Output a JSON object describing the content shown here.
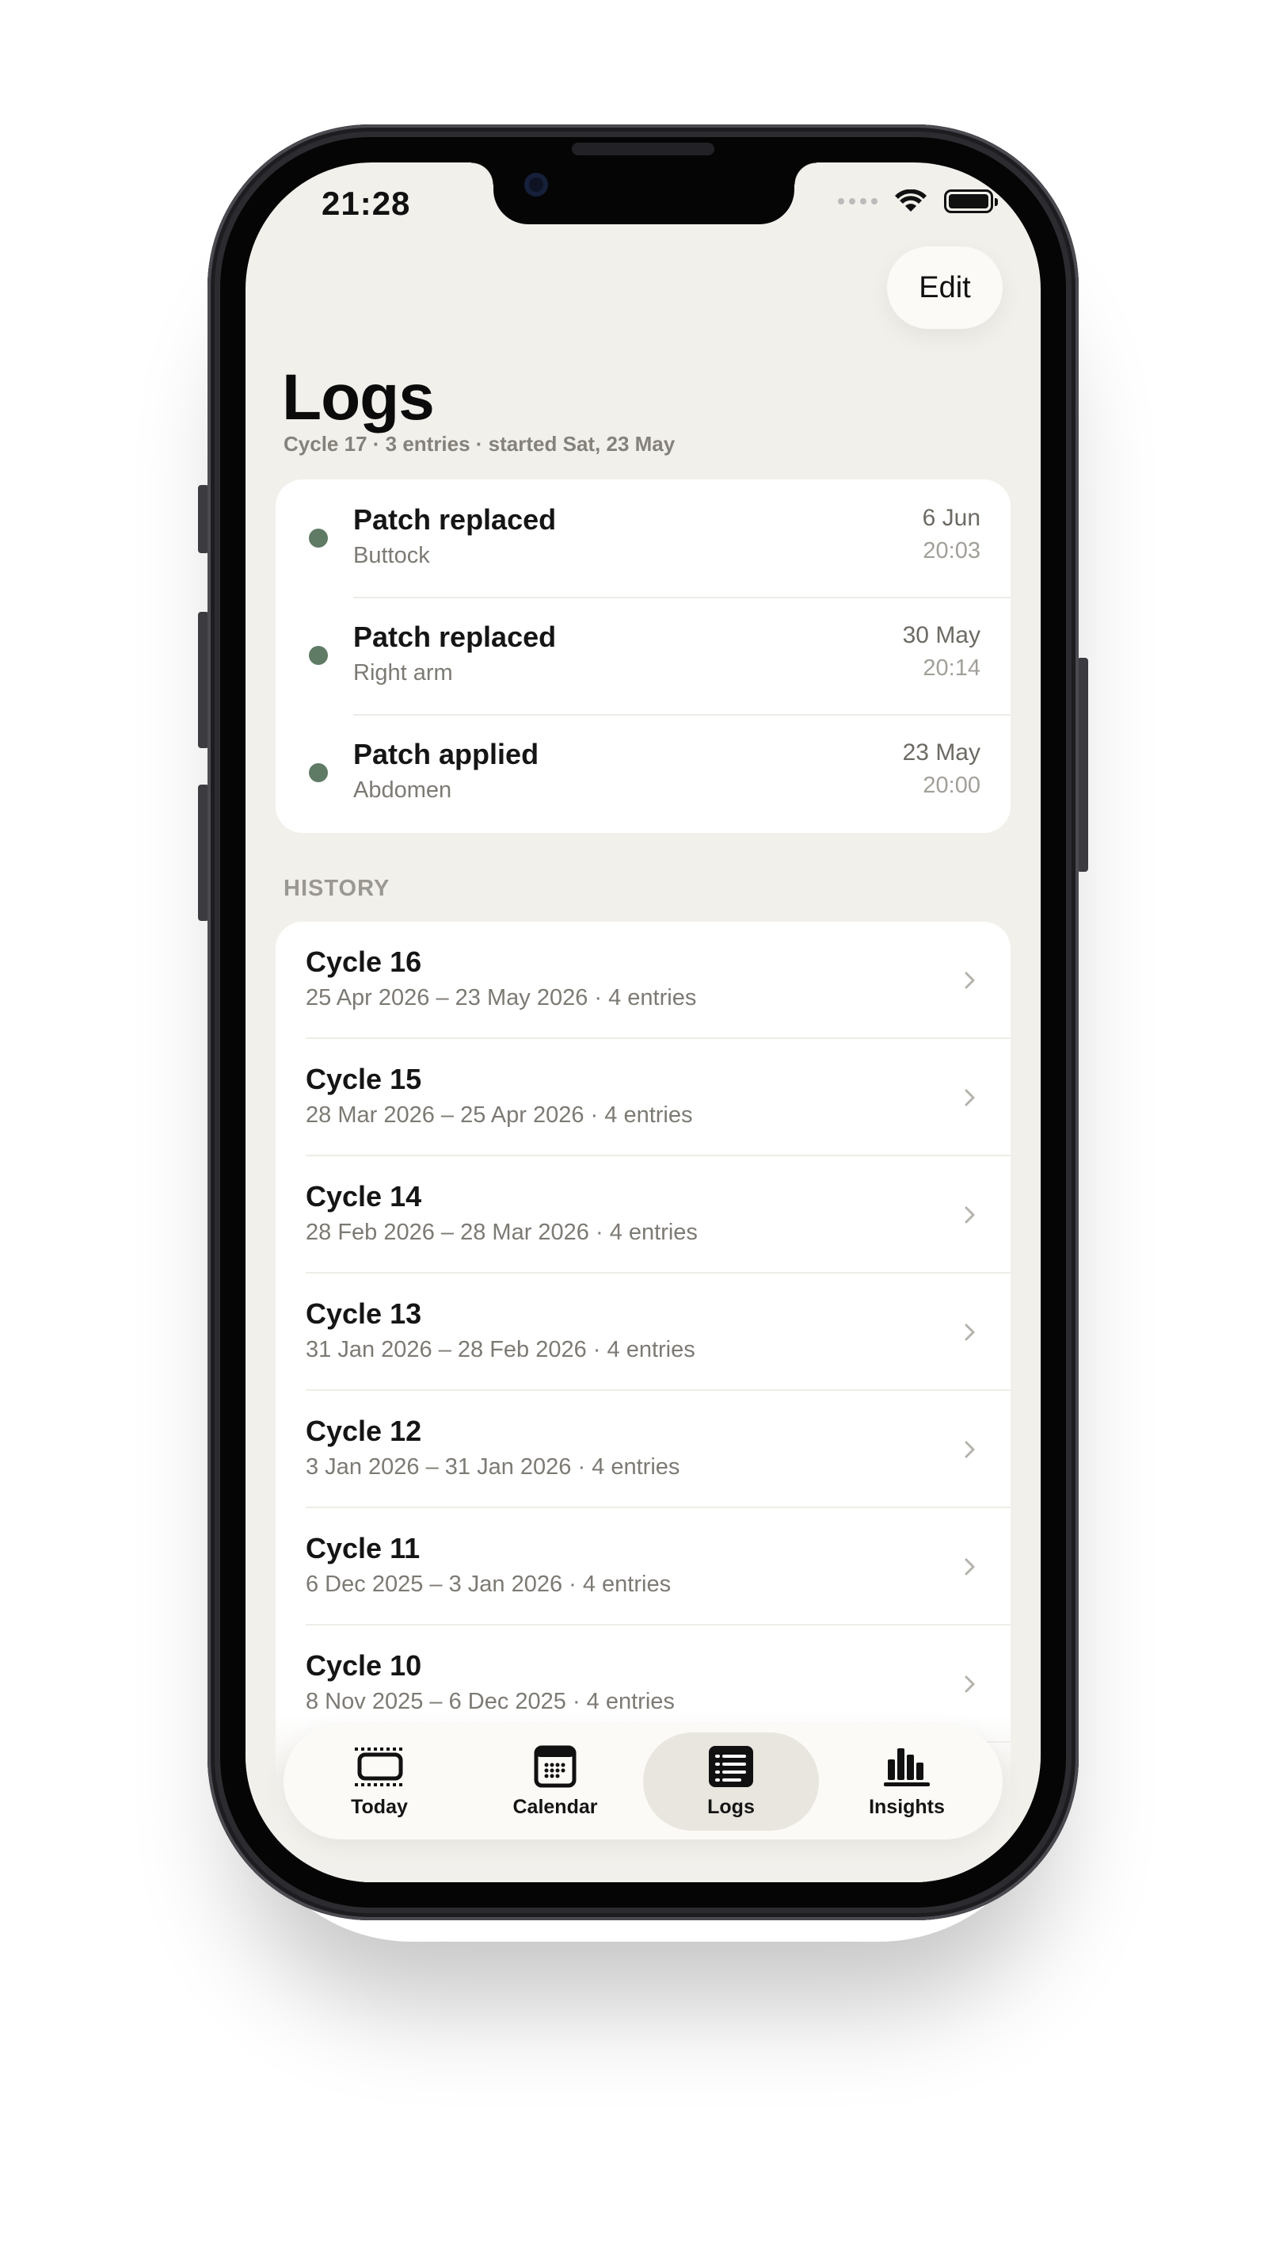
{
  "status_bar": {
    "time": "21:28"
  },
  "toolbar": {
    "edit_label": "Edit"
  },
  "header": {
    "title": "Logs",
    "subtitle": "Cycle 17 · 3 entries · started Sat, 23 May"
  },
  "current_entries": [
    {
      "title": "Patch replaced",
      "site": "Buttock",
      "date": "6 Jun",
      "time": "20:03"
    },
    {
      "title": "Patch replaced",
      "site": "Right arm",
      "date": "30 May",
      "time": "20:14"
    },
    {
      "title": "Patch applied",
      "site": "Abdomen",
      "date": "23 May",
      "time": "20:00"
    }
  ],
  "history": {
    "header": "HISTORY",
    "cycles": [
      {
        "title": "Cycle 16",
        "range": "25 Apr 2026 – 23 May 2026 · 4 entries"
      },
      {
        "title": "Cycle 15",
        "range": "28 Mar 2026 – 25 Apr 2026 · 4 entries"
      },
      {
        "title": "Cycle 14",
        "range": "28 Feb 2026 – 28 Mar 2026 · 4 entries"
      },
      {
        "title": "Cycle 13",
        "range": "31 Jan 2026 – 28 Feb 2026 · 4 entries"
      },
      {
        "title": "Cycle 12",
        "range": "3 Jan 2026 – 31 Jan 2026 · 4 entries"
      },
      {
        "title": "Cycle 11",
        "range": "6 Dec 2025 – 3 Jan 2026 · 4 entries"
      },
      {
        "title": "Cycle 10",
        "range": "8 Nov 2025 – 6 Dec 2025 · 4 entries"
      }
    ]
  },
  "tab_bar": {
    "tabs": [
      {
        "label": "Today",
        "icon": "today-icon"
      },
      {
        "label": "Calendar",
        "icon": "calendar-icon"
      },
      {
        "label": "Logs",
        "icon": "logs-icon",
        "active": true
      },
      {
        "label": "Insights",
        "icon": "insights-icon"
      }
    ]
  },
  "colors": {
    "background": "#f2f0eb",
    "card": "#ffffff",
    "entry_dot": "#5f7a65",
    "active_tab": "#e9e6df"
  }
}
